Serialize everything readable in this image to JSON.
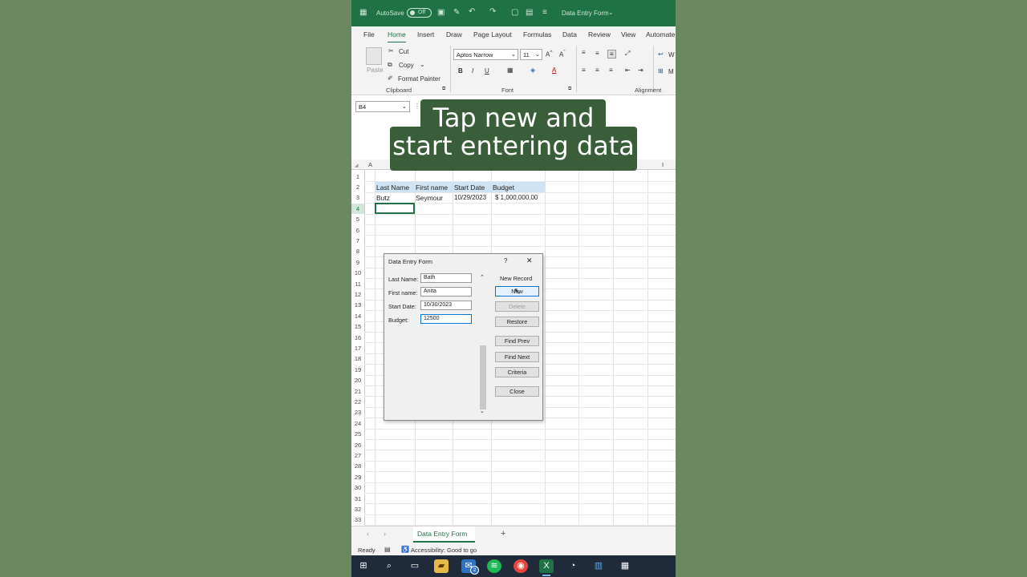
{
  "titlebar": {
    "autosave": "AutoSave",
    "toggle": "Off",
    "doc_title": "Data Entry Form"
  },
  "tabs": [
    "File",
    "Home",
    "Insert",
    "Draw",
    "Page Layout",
    "Formulas",
    "Data",
    "Review",
    "View",
    "Automate"
  ],
  "ribbon": {
    "paste": "Paste",
    "cut": "Cut",
    "copy": "Copy",
    "format_painter": "Format Painter",
    "clipboard_group": "Clipboard",
    "font_name": "Aptos Narrow",
    "font_size": "11",
    "font_group": "Font",
    "alignment_group": "Alignment",
    "wrap": "W",
    "merge": "M"
  },
  "namebox": "B4",
  "caption": {
    "line1": "Tap new and",
    "line2": "start entering data"
  },
  "columns": [
    "A",
    "I"
  ],
  "rows": [
    "1",
    "2",
    "3",
    "4",
    "5",
    "6",
    "7",
    "8",
    "9",
    "10",
    "11",
    "12",
    "13",
    "14",
    "15",
    "16",
    "17",
    "18",
    "19",
    "20",
    "21",
    "22",
    "23",
    "24",
    "25",
    "26",
    "27",
    "28",
    "29",
    "30",
    "31",
    "32",
    "33"
  ],
  "table": {
    "headers": [
      "Last Name",
      "First name",
      "Start Date",
      "Budget"
    ],
    "row": [
      "Butz",
      "Seymour",
      "10/29/2023",
      "$ 1,000,000.00"
    ]
  },
  "dialog": {
    "title": "Data Entry Form",
    "help": "?",
    "close_x": "✕",
    "fields": [
      {
        "label": "Last Name:",
        "value": "Bath"
      },
      {
        "label": "First name:",
        "value": "Anita"
      },
      {
        "label": "Start Date:",
        "value": "10/30/2023"
      },
      {
        "label": "Budget:",
        "value": "12500"
      }
    ],
    "status": "New Record",
    "buttons": {
      "new": "New",
      "delete": "Delete",
      "restore": "Restore",
      "find_prev": "Find Prev",
      "find_next": "Find Next",
      "criteria": "Criteria",
      "close": "Close"
    }
  },
  "sheet_tab": "Data Entry Form",
  "status": {
    "ready": "Ready",
    "accessibility": "Accessibility: Good to go"
  },
  "taskbar": {
    "mail_badge": "2"
  }
}
